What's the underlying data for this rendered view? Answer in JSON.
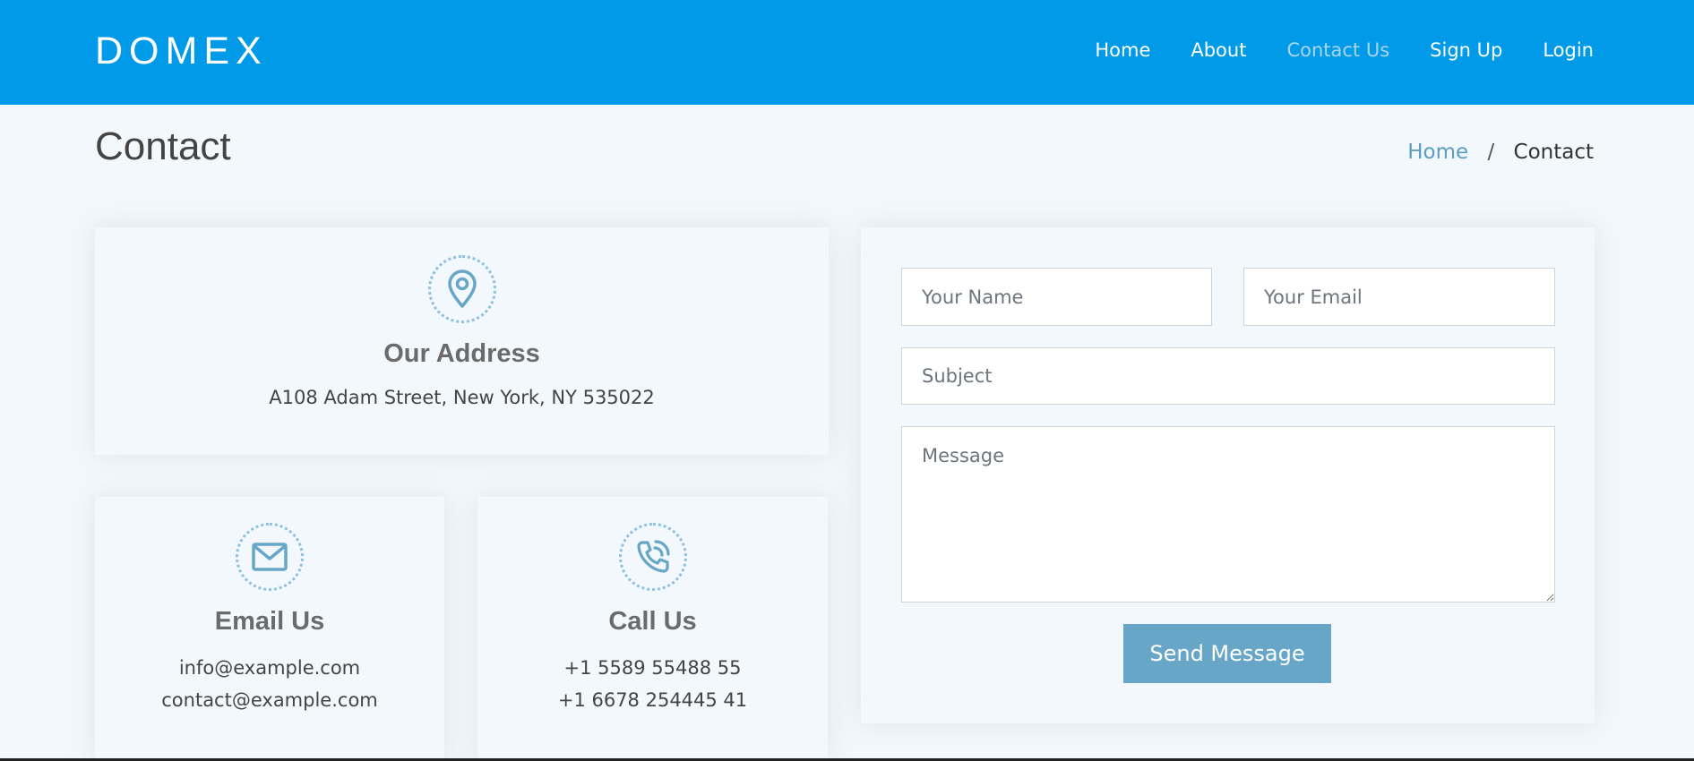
{
  "header": {
    "logo": "DOMEX",
    "nav": [
      {
        "label": "Home"
      },
      {
        "label": "About"
      },
      {
        "label": "Contact Us",
        "active": true
      },
      {
        "label": "Sign Up"
      },
      {
        "label": "Login"
      }
    ]
  },
  "page": {
    "title": "Contact",
    "breadcrumb": {
      "home": "Home",
      "separator": "/",
      "current": "Contact"
    }
  },
  "info": {
    "address": {
      "icon": "map-pin-icon",
      "title": "Our Address",
      "text": "A108 Adam Street, New York, NY 535022"
    },
    "email": {
      "icon": "envelope-icon",
      "title": "Email Us",
      "lines": [
        "info@example.com",
        "contact@example.com"
      ]
    },
    "phone": {
      "icon": "phone-call-icon",
      "title": "Call Us",
      "lines": [
        "+1 5589 55488 55",
        "+1 6678 254445 41"
      ]
    }
  },
  "form": {
    "name_placeholder": "Your Name",
    "email_placeholder": "Your Email",
    "subject_placeholder": "Subject",
    "message_placeholder": "Message",
    "submit_label": "Send Message"
  },
  "colors": {
    "header_bg": "#009ae8",
    "page_bg": "#f2f8fb",
    "accent": "#68a6c8",
    "active_nav": "#a8d6f1",
    "breadcrumb_link": "#5c9dc6"
  }
}
